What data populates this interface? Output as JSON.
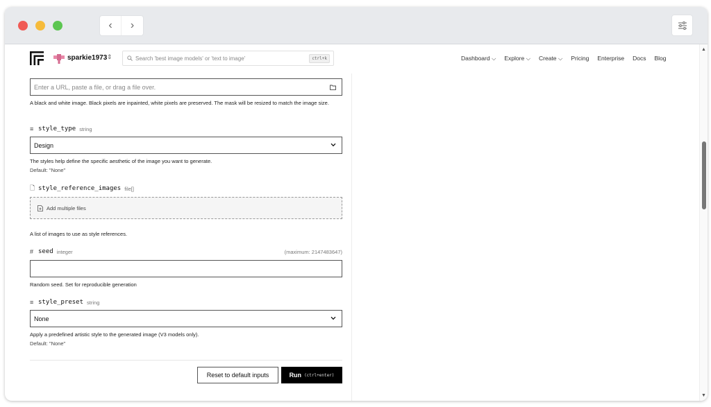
{
  "header": {
    "username": "sparkie1973",
    "search_placeholder": "Search 'best image models' or 'text to image'",
    "search_shortcut": "ctrl+k",
    "nav": [
      "Dashboard ⌵",
      "Explore ⌵",
      "Create ⌵",
      "Pricing",
      "Enterprise",
      "Docs",
      "Blog"
    ]
  },
  "form": {
    "mask": {
      "placeholder": "Enter a URL, paste a file, or drag a file over.",
      "help": "A black and white image. Black pixels are inpainted, white pixels are preserved. The mask will be resized to match the image size."
    },
    "style_type": {
      "name": "style_type",
      "type": "string",
      "value": "Design",
      "help": "The styles help define the specific aesthetic of the image you want to generate.",
      "default": "Default: \"None\""
    },
    "style_reference_images": {
      "name": "style_reference_images",
      "type": "file[]",
      "add_label": "Add multiple files",
      "help": "A list of images to use as style references."
    },
    "seed": {
      "name": "seed",
      "type": "integer",
      "max": "(maximum: 2147483647)",
      "value": "",
      "help": "Random seed. Set for reproducible generation"
    },
    "style_preset": {
      "name": "style_preset",
      "type": "string",
      "value": "None",
      "help": "Apply a predefined artistic style to the generated image (V3 models only).",
      "default": "Default: \"None\""
    },
    "reset_label": "Reset to default inputs",
    "run_label": "Run",
    "run_shortcut": "(ctrl+enter)"
  },
  "icons": {
    "logo": "brand-logo-icon",
    "folder": "folder-icon",
    "file": "file-icon",
    "search": "search-icon",
    "chevron": "chevron-down-icon",
    "settings": "sliders-icon"
  }
}
